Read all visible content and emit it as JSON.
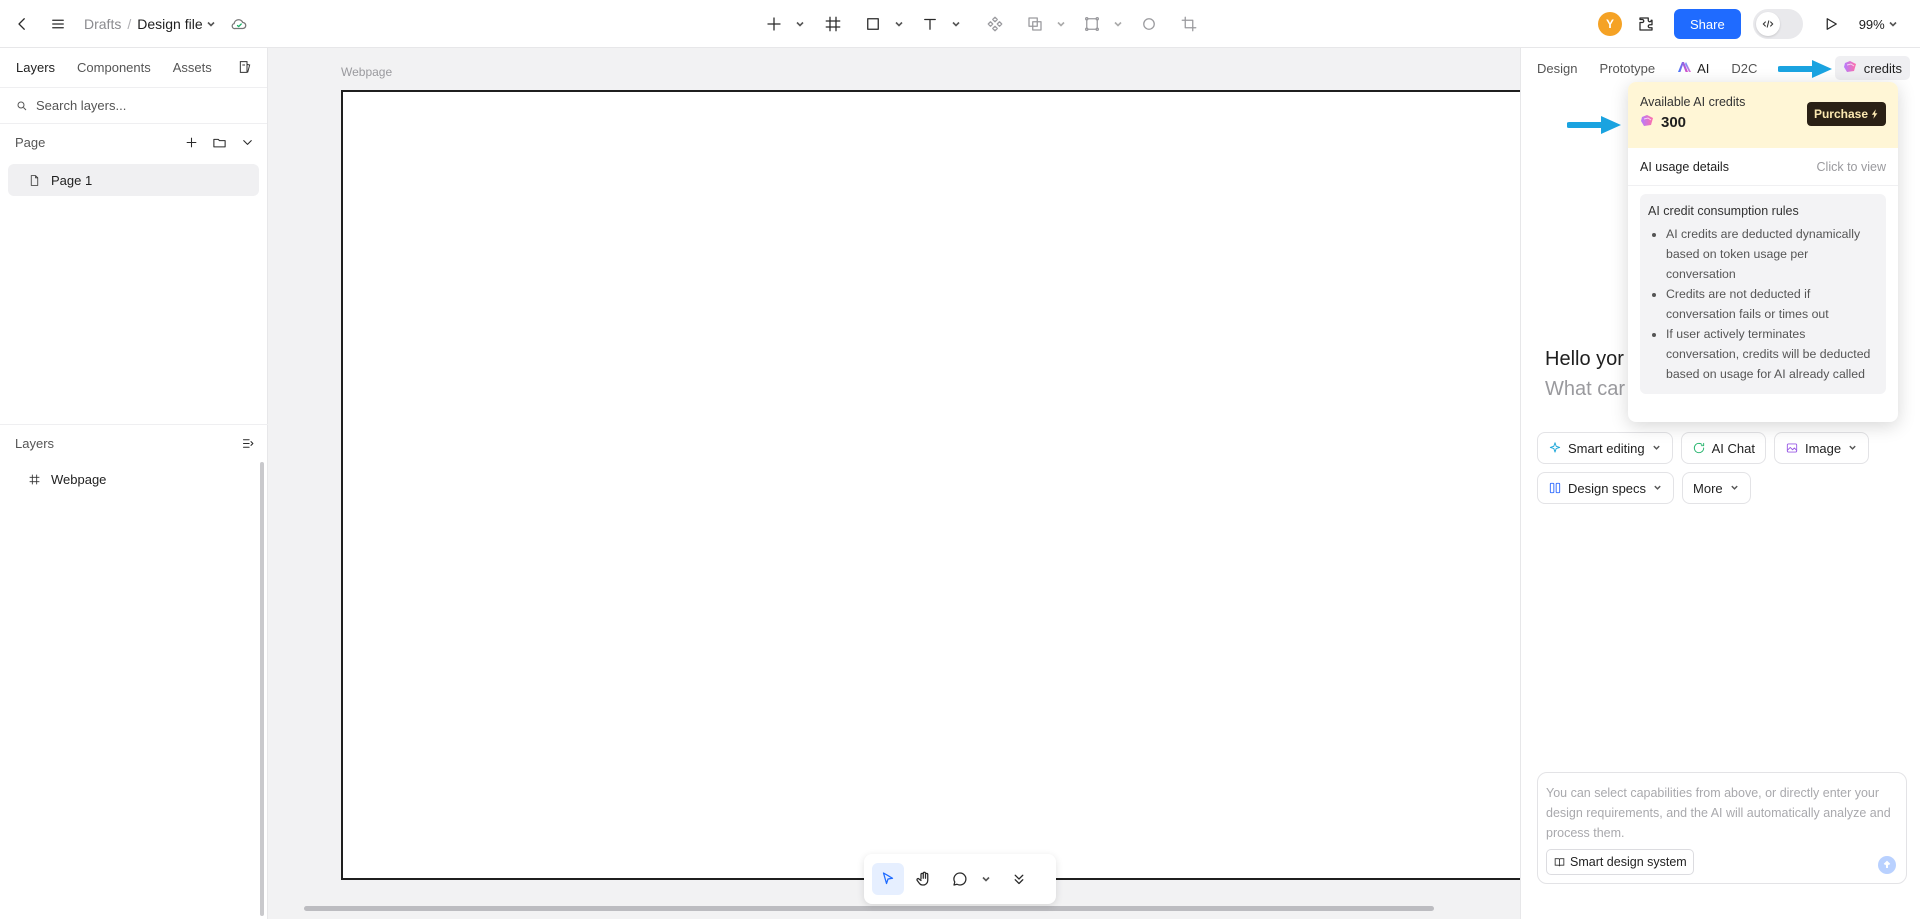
{
  "topbar": {
    "breadcrumb_parent": "Drafts",
    "breadcrumb_sep": "/",
    "file_name": "Design file",
    "avatar_initial": "Y",
    "share_label": "Share",
    "zoom": "99%"
  },
  "left_panel": {
    "tabs": [
      "Layers",
      "Components",
      "Assets"
    ],
    "search_placeholder": "Search layers...",
    "page_section": "Page",
    "pages": [
      "Page 1"
    ],
    "layers_section": "Layers",
    "layers": [
      "Webpage"
    ]
  },
  "canvas": {
    "frame_label": "Webpage"
  },
  "right_panel": {
    "tabs": [
      "Design",
      "Prototype",
      "AI",
      "D2C"
    ],
    "credits_label": "credits",
    "hello": "Hello yor",
    "what": "What car",
    "chips": [
      {
        "label": "Smart editing",
        "icon": "sparkle-icon",
        "color": "#1fa8d9"
      },
      {
        "label": "AI Chat",
        "icon": "chat-refresh-icon",
        "color": "#23b36b"
      },
      {
        "label": "Image",
        "icon": "image-icon",
        "color": "#9b5de5"
      },
      {
        "label": "Design specs",
        "icon": "columns-icon",
        "color": "#2f6bff"
      },
      {
        "label": "More",
        "icon": "",
        "color": ""
      }
    ],
    "chat_placeholder": "You can select capabilities from above, or directly enter your design requirements, and the AI will automatically analyze and process them.",
    "smart_design_system": "Smart design system"
  },
  "credits_popover": {
    "available_label": "Available AI credits",
    "amount": "300",
    "purchase_label": "Purchase",
    "usage_label": "AI usage details",
    "usage_action": "Click to view",
    "rules_title": "AI credit consumption rules",
    "rules": [
      "AI credits are deducted dynamically based on token usage per conversation",
      "Credits are not deducted if conversation fails or times out",
      "If user actively terminates conversation, credits will be deducted based on usage for AI already called"
    ]
  },
  "colors": {
    "accent": "#1f6bff",
    "annotation_arrow": "#1aa3e0",
    "popover_header": "#fff6d6",
    "avatar": "#f5a225"
  }
}
